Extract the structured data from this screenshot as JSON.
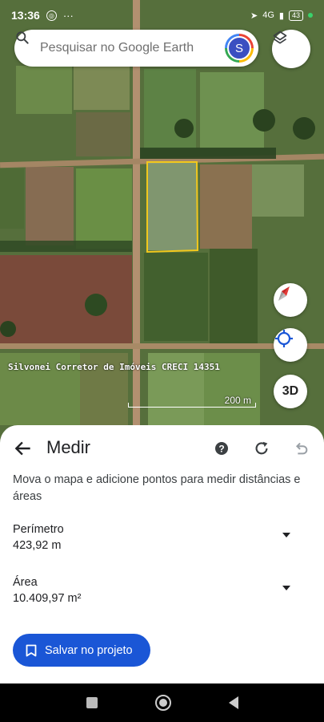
{
  "status_bar": {
    "time": "13:36",
    "network": "4G",
    "battery": "43"
  },
  "search": {
    "placeholder": "Pesquisar no Google Earth",
    "avatar_letter": "S"
  },
  "map": {
    "watermark": "Silvonei Corretor de Imóveis CRECI 14351",
    "scale_label": "200 m",
    "button_3d": "3D",
    "polygon_color": "#f2c81c"
  },
  "measure": {
    "title": "Medir",
    "instructions": "Mova o mapa e adicione pontos para medir distâncias e áreas",
    "perimeter_label": "Perímetro",
    "perimeter_value": "423,92 m",
    "area_label": "Área",
    "area_value": "10.409,97 m²",
    "save_label": "Salvar no projeto"
  },
  "icons": {
    "back": "arrow-left-icon",
    "help": "help-circle-icon",
    "redo": "redo-icon",
    "undo": "undo-icon",
    "layers": "layers-icon",
    "compass": "compass-icon",
    "locate": "my-location-icon",
    "search": "search-icon",
    "bookmark": "bookmark-icon"
  },
  "colors": {
    "accent": "#1a56d6",
    "text": "#202124"
  }
}
